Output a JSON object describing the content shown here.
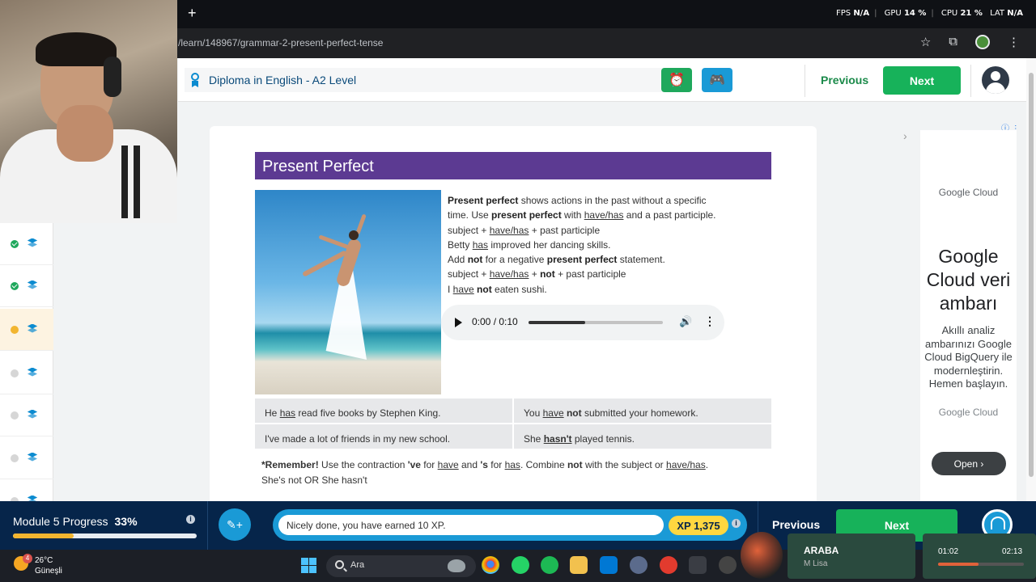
{
  "browser": {
    "url": "/learn/148967/grammar-2-present-perfect-tense",
    "new_tab": "+",
    "stats": {
      "fps_label": "FPS",
      "fps": "N/A",
      "gpu_label": "GPU",
      "gpu": "14 %",
      "cpu_label": "CPU",
      "cpu": "21 %",
      "lat_label": "LAT",
      "lat": "N/A"
    }
  },
  "header": {
    "course_title": "Diploma in English - A2 Level",
    "previous": "Previous",
    "next": "Next"
  },
  "sidebar": {
    "items": [
      {
        "status": "done"
      },
      {
        "status": "done"
      },
      {
        "status": "in-progress"
      },
      {
        "status": "todo"
      },
      {
        "status": "todo"
      },
      {
        "status": "todo"
      },
      {
        "status": "todo"
      }
    ]
  },
  "lesson": {
    "title": "Present Perfect",
    "text": {
      "l1_bold": "Present perfect",
      "l1_rest": " shows actions in the past without a specific",
      "l2_a": "time.  Use ",
      "l2_bold": "present perfect",
      "l2_b": " with ",
      "l2_u": "have/has",
      "l2_c": " and a past participle.",
      "l3_a": "subject + ",
      "l3_u": "have/has",
      "l3_b": " + past participle",
      "l4_a": "Betty ",
      "l4_u": "has",
      "l4_b": " improved her dancing skills.",
      "l5_a": "Add ",
      "l5_bold1": "not",
      "l5_b": " for a negative ",
      "l5_bold2": "present perfect",
      "l5_c": " statement.",
      "l6_a": "subject + ",
      "l6_u": "have/has",
      "l6_b": " + ",
      "l6_bold": "not",
      "l6_c": " + past participle",
      "l7_a": "I ",
      "l7_u": "have",
      "l7_b": " ",
      "l7_bold": "not",
      "l7_c": " eaten sushi."
    },
    "audio": {
      "time": "0:00 / 0:10",
      "progress": 0.42
    },
    "examples": {
      "e1_a": "He ",
      "e1_u": "has",
      "e1_b": " read five books by Stephen King.",
      "e2_a": "You ",
      "e2_u": "have",
      "e2_b": " ",
      "e2_bold": "not",
      "e2_c": " submitted your homework.",
      "e3": "I've made a lot of friends in my new school.",
      "e4_a": "She ",
      "e4_u": "hasn't",
      "e4_b": " played tennis."
    },
    "remember": {
      "bold": "*Remember!",
      "a": " Use the contraction ",
      "ve": "'ve",
      "b": " for ",
      "u1": "have",
      "c": " and ",
      "s": "'s",
      "d": " for ",
      "u2": "has",
      "e": ".  Combine ",
      "not": "not",
      "f": " with the subject or ",
      "u3": "have/has",
      "g": ".",
      "line2": "She's not OR She hasn't"
    }
  },
  "ad": {
    "logo": "Google Cloud",
    "headline": "Google Cloud veri ambarı",
    "body": "Akıllı analiz ambarınızı Google Cloud BigQuery ile modernleştirin. Hemen başlayın.",
    "brand": "Google Cloud",
    "cta": "Open"
  },
  "bottom": {
    "module_label": "Module 5 Progress",
    "module_percent": "33%",
    "module_progress": 0.33,
    "message": "Nicely done, you have earned 10 XP.",
    "xp": "XP 1,375",
    "previous": "Previous",
    "next": "Next"
  },
  "taskbar": {
    "weather_badge": "4",
    "temp": "26°C",
    "condition": "Güneşli",
    "search_placeholder": "Ara",
    "music_title": "ARABA",
    "music_artist": "M Lisa",
    "time_current": "01:02",
    "time_total": "02:13",
    "time_progress": 0.47
  },
  "colors": {
    "accent_green": "#17b25a",
    "accent_blue": "#1a9ad6",
    "lesson_purple": "#5c3a92",
    "bar_navy": "#06254a"
  }
}
